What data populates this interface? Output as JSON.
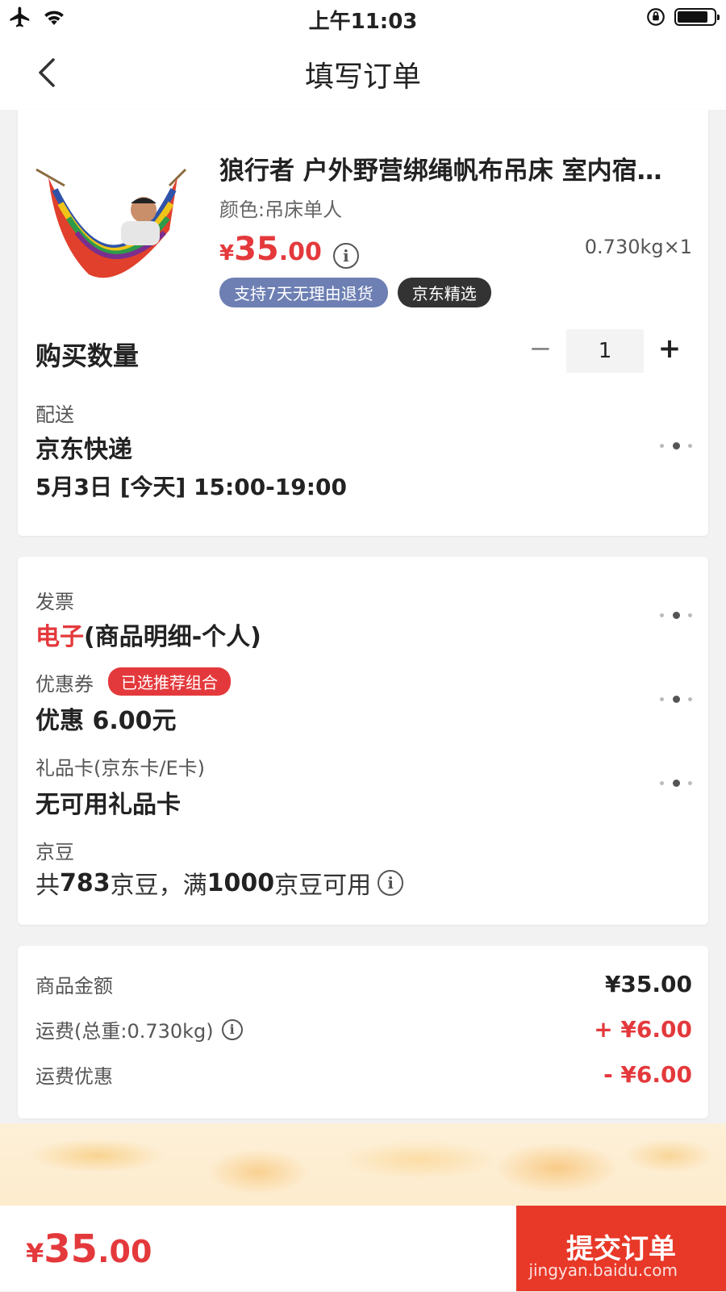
{
  "status_bar": {
    "time": "上午11:03",
    "icons": [
      "airplane-icon",
      "wifi-icon",
      "orientation-lock-icon",
      "battery-icon"
    ],
    "battery_level": 0.85
  },
  "nav": {
    "back_icon": "chevron-left-icon",
    "title": "填写订单"
  },
  "product": {
    "title": "狼行者 户外野营绑绳帆布吊床 室内宿…",
    "spec": "颜色:吊床单人",
    "price_yen": "¥",
    "price_int": "35",
    "price_dec": ".00",
    "price_info_icon": "info-icon",
    "weight": "0.730kg×1",
    "tags": [
      "支持7天无理由退货",
      "京东精选"
    ],
    "tag_colors": [
      "#6d7fb3",
      "#333333"
    ]
  },
  "quantity": {
    "label": "购买数量",
    "minus": "−",
    "value": "1",
    "plus": "+"
  },
  "delivery": {
    "label": "配送",
    "carrier": "京东快递",
    "time": "5月3日 [今天] 15:00-19:00"
  },
  "invoice": {
    "label": "发票",
    "value_highlight": "电子",
    "value_rest": "(商品明细-个人)"
  },
  "coupon": {
    "label": "优惠券",
    "badge": "已选推荐组合",
    "value": "优惠 6.00元"
  },
  "gift_card": {
    "label": "礼品卡(京东卡/E卡)",
    "value": "无可用礼品卡"
  },
  "jd_bean": {
    "label": "京豆",
    "text_1": "共",
    "count": "783",
    "text_2": "京豆，满",
    "threshold": "1000",
    "text_3": "京豆可用"
  },
  "summary": {
    "goods_label": "商品金额",
    "goods_value": "¥35.00",
    "freight_label": "运费(总重:0.730kg)",
    "freight_value": "+ ¥6.00",
    "freight_discount_label": "运费优惠",
    "freight_discount_value": "- ¥6.00"
  },
  "footer": {
    "total_yen": "¥",
    "total_int": "35",
    "total_dec": ".00",
    "submit_label": "提交订单",
    "watermark": "jingyan.baidu.com"
  },
  "colors": {
    "accent_red": "#e4393c",
    "submit_red": "#e83828"
  }
}
